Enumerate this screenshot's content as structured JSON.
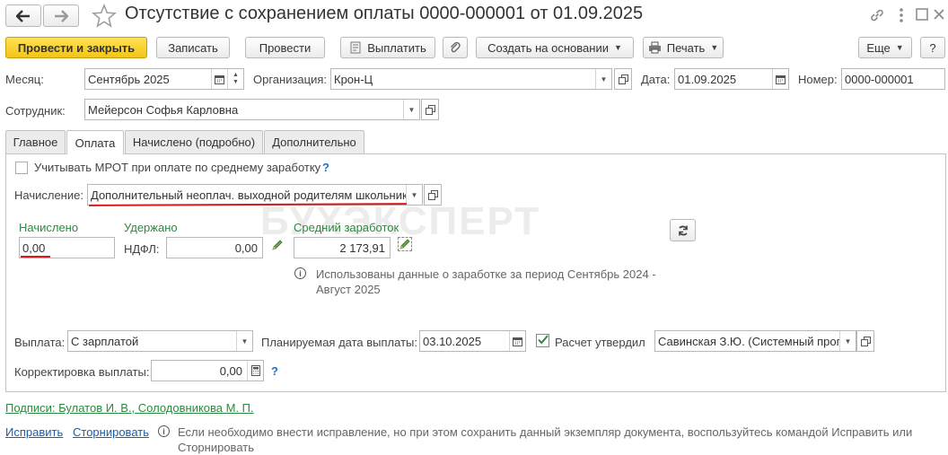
{
  "window": {
    "title": "Отсутствие с сохранением оплаты 0000-000001 от 01.09.2025"
  },
  "toolbar": {
    "post_close": "Провести и закрыть",
    "save": "Записать",
    "post": "Провести",
    "pay": "Выплатить",
    "create_based": "Создать на основании",
    "print": "Печать",
    "more": "Еще",
    "help": "?"
  },
  "header": {
    "month_label": "Месяц:",
    "month_value": "Сентябрь 2025",
    "org_label": "Организация:",
    "org_value": "Крон-Ц",
    "date_label": "Дата:",
    "date_value": "01.09.2025",
    "number_label": "Номер:",
    "number_value": "0000-000001",
    "employee_label": "Сотрудник:",
    "employee_value": "Мейерсон Софья Карловна"
  },
  "tabs": [
    {
      "label": "Главное"
    },
    {
      "label": "Оплата"
    },
    {
      "label": "Начислено (подробно)"
    },
    {
      "label": "Дополнительно"
    }
  ],
  "payment": {
    "mrot_label": "Учитывать МРОТ при оплате по среднему заработку",
    "mrot_checked": false,
    "help_mark": "?",
    "accrual_label": "Начисление:",
    "accrual_value": "Дополнительный неоплач. выходной родителям школьник",
    "accrued_label": "Начислено",
    "accrued_value": "0,00",
    "withheld_label": "Удержано",
    "ndfl_label": "НДФЛ:",
    "ndfl_value": "0,00",
    "avg_label": "Средний заработок",
    "avg_value": "2 173,91",
    "info_text": "Использованы данные о заработке за период Сентябрь 2024 - Август 2025",
    "payout_label": "Выплата:",
    "payout_value": "С зарплатой",
    "planned_date_label": "Планируемая дата выплаты:",
    "planned_date_value": "03.10.2025",
    "approved_label": "Расчет утвердил",
    "approved_checked": true,
    "approver_value": "Савинская З.Ю. (Системный прог",
    "correction_label": "Корректировка выплаты:",
    "correction_value": "0,00"
  },
  "footer": {
    "signatures": "Подписи: Булатов И. В., Солодовникова М. П.",
    "fix_link": "Исправить",
    "storno_link": "Сторнировать",
    "info_text": "Если необходимо внести исправление, но при этом сохранить данный экземпляр документа, воспользуйтесь командой Исправить или Сторнировать"
  },
  "watermark": "БУХЭКСПЕРТ",
  "colors": {
    "primary_button": "#f4c419",
    "green_label": "#2b8a3e",
    "link": "#1a5ea8",
    "highlight_line": "#d9181a"
  }
}
